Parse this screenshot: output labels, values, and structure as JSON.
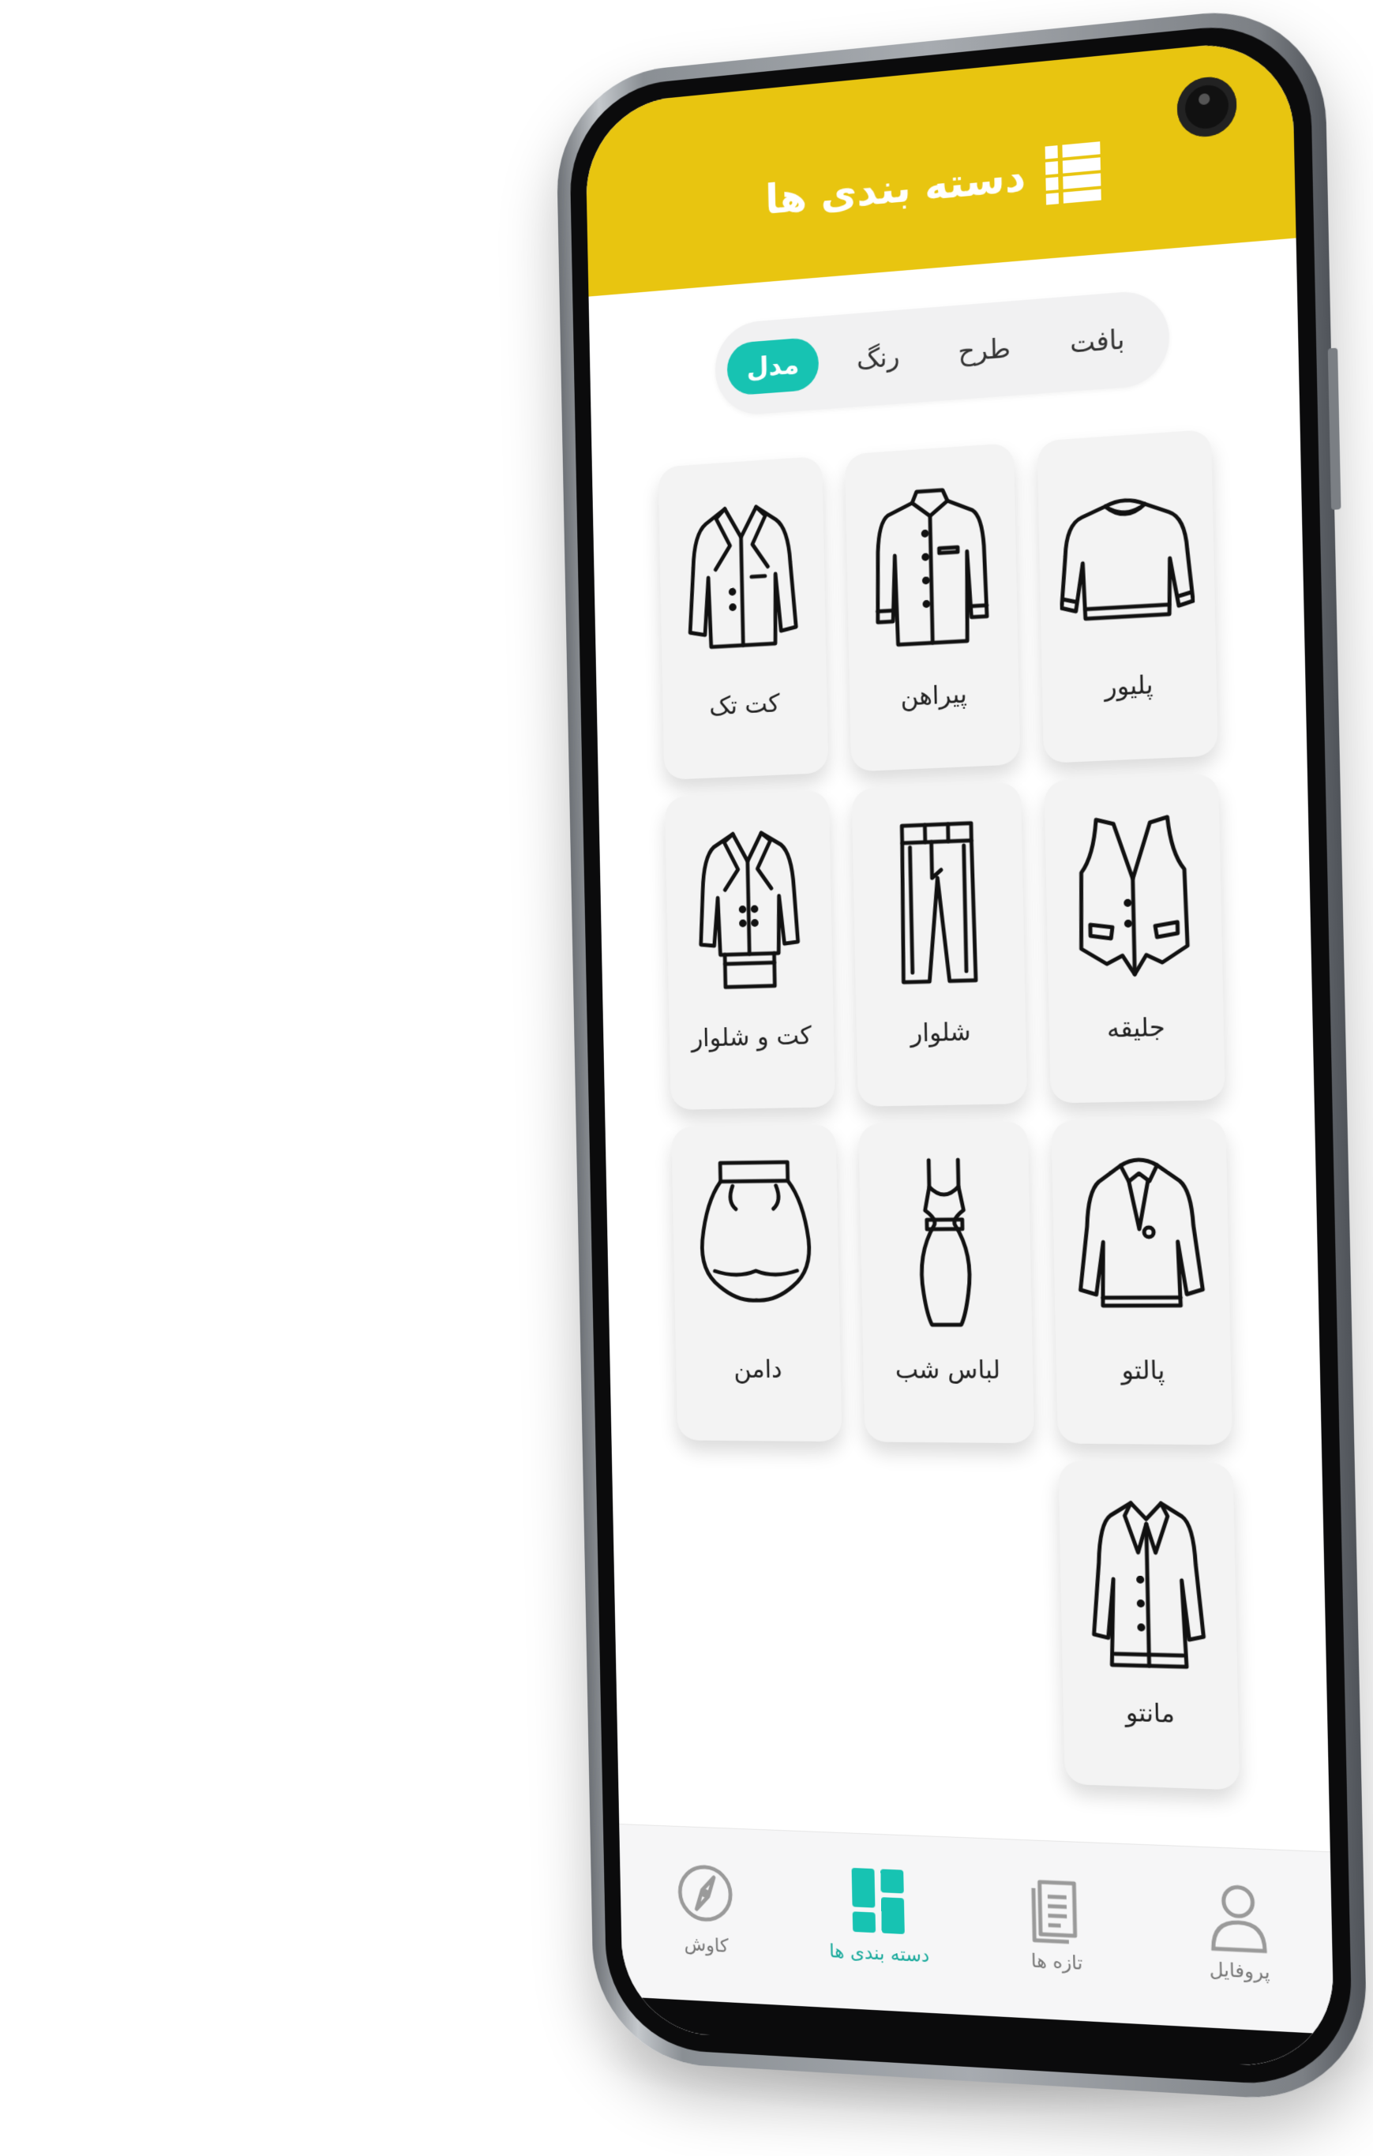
{
  "header": {
    "title": "دسته بندی ها",
    "icon": "categories-list-icon",
    "background": "#e8c510"
  },
  "tabs": {
    "accent": "#17c3b2",
    "items": [
      {
        "label": "بافت",
        "active": false
      },
      {
        "label": "طرح",
        "active": false
      },
      {
        "label": "رنگ",
        "active": false
      },
      {
        "label": "مدل",
        "active": true
      }
    ]
  },
  "categories": [
    {
      "label": "پلیور",
      "icon": "sweater-icon"
    },
    {
      "label": "پیراهن",
      "icon": "shirt-icon"
    },
    {
      "label": "کت تک",
      "icon": "blazer-icon"
    },
    {
      "label": "جلیقه",
      "icon": "vest-icon"
    },
    {
      "label": "شلوار",
      "icon": "trousers-icon"
    },
    {
      "label": "کت و شلوار",
      "icon": "suit-icon"
    },
    {
      "label": "پالتو",
      "icon": "coat-icon"
    },
    {
      "label": "لباس شب",
      "icon": "evening-dress-icon"
    },
    {
      "label": "دامن",
      "icon": "skirt-icon"
    },
    {
      "label": "مانتو",
      "icon": "manteau-icon"
    }
  ],
  "bottom_nav": {
    "items": [
      {
        "label": "پروفایل",
        "icon": "profile-icon",
        "active": false
      },
      {
        "label": "تازه ها",
        "icon": "news-icon",
        "active": false
      },
      {
        "label": "دسته بندی ها",
        "icon": "categories-icon",
        "active": true
      },
      {
        "label": "کاوش",
        "icon": "compass-icon",
        "active": false
      }
    ]
  }
}
